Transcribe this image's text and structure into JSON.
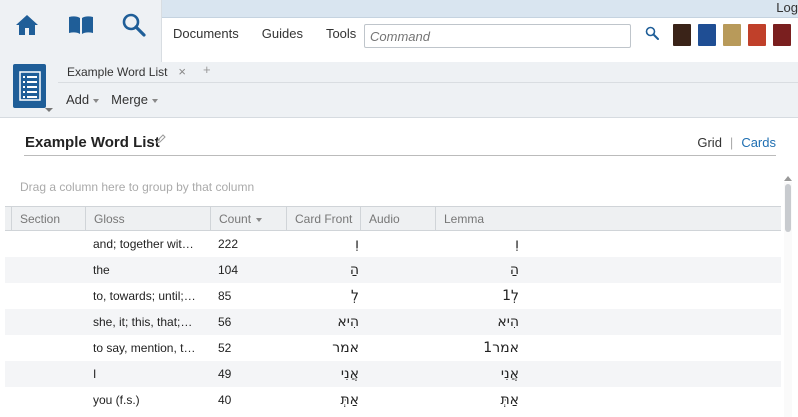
{
  "top": {
    "log_label": "Log",
    "menu": [
      "Documents",
      "Guides",
      "Tools"
    ],
    "command_placeholder": "Command",
    "book_colors": [
      "#3a2318",
      "#1f4e94",
      "#b89a5a",
      "#c0402a",
      "#7a1f1f"
    ]
  },
  "panel": {
    "tab_label": "Example Word List",
    "tab_close": "×",
    "tab_add": "+",
    "add_label": "Add",
    "merge_label": "Merge"
  },
  "list": {
    "title": "Example Word List",
    "view_grid": "Grid",
    "view_sep": "|",
    "view_cards": "Cards",
    "group_hint": "Drag a column here to group by that column"
  },
  "columns": [
    "Section",
    "Gloss",
    "Count",
    "Card Front",
    "Audio",
    "Lemma"
  ],
  "rows": [
    {
      "gloss": "and; together wit…",
      "count": "222",
      "front": "וְ",
      "lemma": "וְ"
    },
    {
      "gloss": "the",
      "count": "104",
      "front": "הַ",
      "lemma": "הַ"
    },
    {
      "gloss": "to, towards; until;…",
      "count": "85",
      "front": "לְ",
      "lemma": "לְ1"
    },
    {
      "gloss": "she, it; this, that;…",
      "count": "56",
      "front": "הִיא",
      "lemma": "הִיא"
    },
    {
      "gloss": "to say, mention, t…",
      "count": "52",
      "front": "אמר",
      "lemma": "אמר1"
    },
    {
      "gloss": "I",
      "count": "49",
      "front": "אֲנִי",
      "lemma": "אֲנִי"
    },
    {
      "gloss": "you (f.s.)",
      "count": "40",
      "front": "אַתְּ",
      "lemma": "אַתְּ"
    }
  ],
  "colors": {
    "accent": "#1f5e98",
    "link": "#1f6fb2"
  }
}
